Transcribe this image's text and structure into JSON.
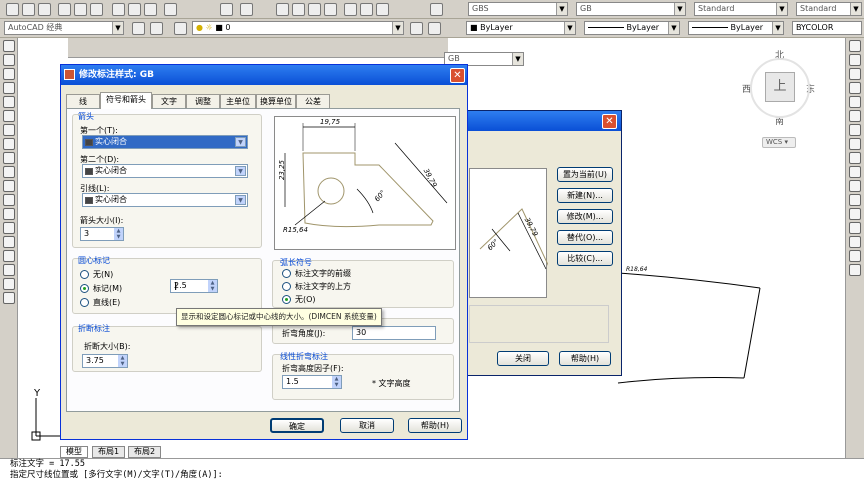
{
  "toolbar": {
    "row1_combos": [
      "GBS",
      "GB",
      "Standard",
      "Standard"
    ],
    "workspace": "AutoCAD 经典",
    "layer": "0",
    "linetype_layer1": "ByLayer",
    "linetype_layer2": "ByLayer",
    "lineweight_layer": "ByLayer",
    "color": "BYCOLOR",
    "dimstyle_small": "GB"
  },
  "viewcube": {
    "north": "北",
    "south": "南",
    "east": "东",
    "west": "西",
    "top": "上",
    "wcs": "WCS"
  },
  "main_dialog": {
    "title": "修改标注样式: GB",
    "tabs": [
      "线",
      "符号和箭头",
      "文字",
      "调整",
      "主单位",
      "换算单位",
      "公差"
    ],
    "selected_tab": 1,
    "arrow_group": "箭头",
    "first_label": "第一个(T):",
    "first_value": "实心闭合",
    "second_label": "第二个(D):",
    "second_value": "实心闭合",
    "leader_label": "引线(L):",
    "leader_value": "实心闭合",
    "arrow_size_label": "箭头大小(I):",
    "arrow_size_value": "3",
    "center_group": "圆心标记",
    "center_none": "无(N)",
    "center_mark": "标记(M)",
    "center_line": "直线(E)",
    "center_value": "2.5",
    "break_group": "折断标注",
    "break_size_label": "折断大小(B):",
    "break_size_value": "3.75",
    "arc_group": "弧长符号",
    "arc_opt1": "标注文字的前缀",
    "arc_opt2": "标注文字的上方",
    "arc_opt3": "无(O)",
    "radius_label": "半径折弯标注",
    "jog_angle_label": "折弯角度(J):",
    "jog_angle_value": "30",
    "linear_group": "线性折弯标注",
    "jog_height_label": "折弯高度因子(F):",
    "jog_height_value": "1.5",
    "text_height_suffix": "* 文字高度",
    "ok": "确定",
    "cancel": "取消",
    "help": "帮助(H)",
    "preview_texts": {
      "d1": "19,75",
      "d2": "23,25",
      "d3": "39,79",
      "angle": "60°",
      "radius": "R15,64"
    }
  },
  "tooltip": "显示和设定圆心标记或中心线的大小。(DIMCEN 系统变量)",
  "back_dialog": {
    "buttons": [
      "置为当前(U)",
      "新建(N)...",
      "修改(M)...",
      "替代(O)...",
      "比较(C)..."
    ],
    "close": "关闭",
    "help": "帮助(H)",
    "preview_texts": {
      "d3": "39,79",
      "angle": "60°"
    }
  },
  "drawing": {
    "label": "R18,64",
    "y_axis": "Y"
  },
  "layout_tabs": [
    "模型",
    "布局1",
    "布局2"
  ],
  "command": {
    "line1": "标注文字 = 17.55",
    "line2": "指定尺寸线位置或 [多行文字(M)/文字(T)/角度(A)]:"
  }
}
